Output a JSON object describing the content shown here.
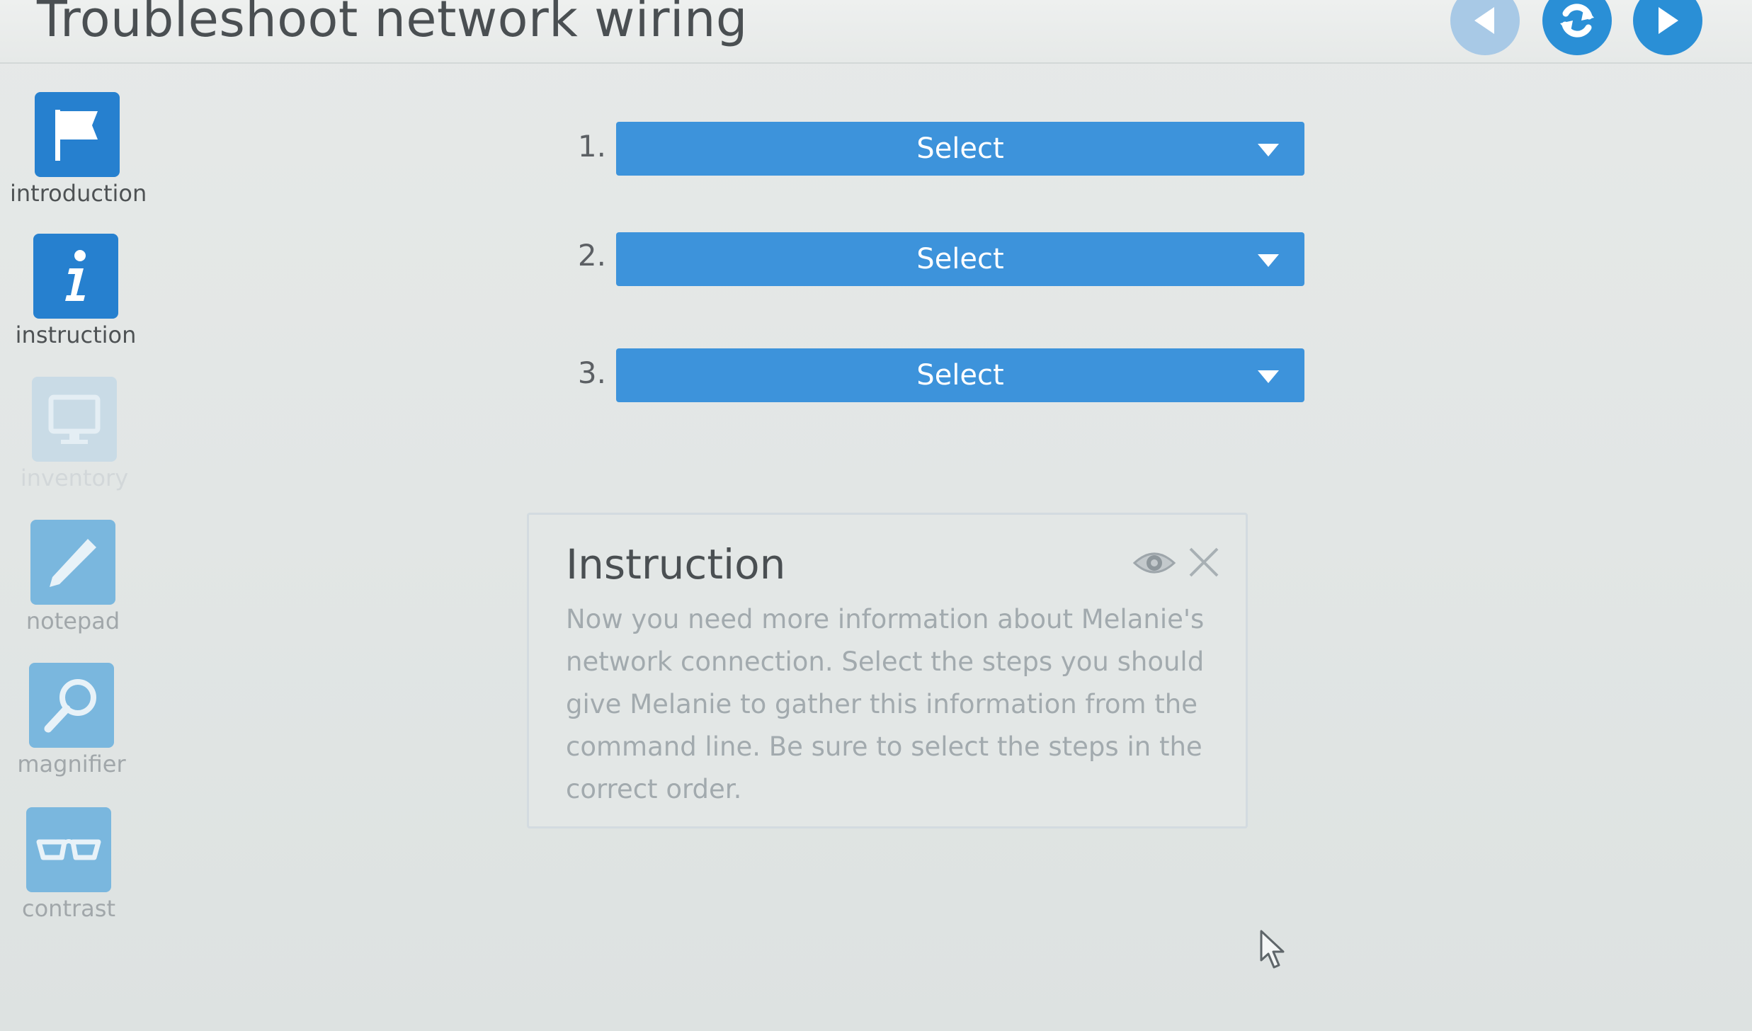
{
  "app": {
    "title": "Troubleshoot network wiring"
  },
  "nav": {
    "prev_icon": "triangle-left-icon",
    "reload_icon": "refresh-icon",
    "next_icon": "triangle-right-icon"
  },
  "sidebar": {
    "items": [
      {
        "label": "introduction",
        "icon": "flag-icon",
        "state": "active"
      },
      {
        "label": "instruction",
        "icon": "info-icon",
        "state": "active"
      },
      {
        "label": "inventory",
        "icon": "monitor-icon",
        "state": "disabled"
      },
      {
        "label": "notepad",
        "icon": "pencil-icon",
        "state": "enabled"
      },
      {
        "label": "magnifier",
        "icon": "magnifier-icon",
        "state": "enabled"
      },
      {
        "label": "contrast",
        "icon": "glasses-icon",
        "state": "enabled"
      }
    ]
  },
  "steps": [
    {
      "number": "1.",
      "value": "Select"
    },
    {
      "number": "2.",
      "value": "Select"
    },
    {
      "number": "3.",
      "value": "Select"
    }
  ],
  "instruction_panel": {
    "title": "Instruction",
    "body": "Now you need more information about Melanie's network connection. Select the steps you should give Melanie to gather this information from the command line. Be sure to select the steps in the correct order."
  },
  "colors": {
    "accent": "#2680cf",
    "select_bg": "#3d93db",
    "tile_light": "#7ab7de",
    "tile_disabled": "#c9dbe6"
  }
}
